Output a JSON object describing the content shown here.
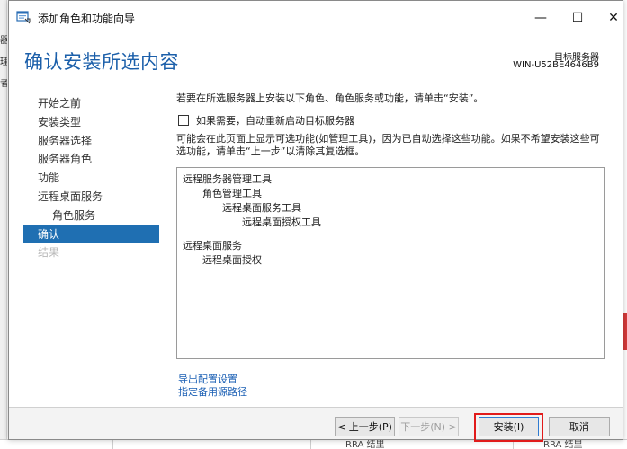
{
  "background": {
    "left_strip_chars": [
      "器",
      "理",
      "者"
    ],
    "bottom_cells": [
      "RRA 结里",
      "RRA 结里"
    ]
  },
  "window": {
    "title": "添加角色和功能向导",
    "minimize_glyph": "—",
    "maximize_glyph": "☐",
    "close_glyph": "✕"
  },
  "header": {
    "page_title": "确认安装所选内容",
    "target_server_label": "目标服务器",
    "target_server_name": "WIN-U52BE4646B9"
  },
  "nav": {
    "items": [
      {
        "label": "开始之前",
        "state": "normal"
      },
      {
        "label": "安装类型",
        "state": "normal"
      },
      {
        "label": "服务器选择",
        "state": "normal"
      },
      {
        "label": "服务器角色",
        "state": "normal"
      },
      {
        "label": "功能",
        "state": "normal"
      },
      {
        "label": "远程桌面服务",
        "state": "normal"
      },
      {
        "label": "角色服务",
        "state": "sub"
      },
      {
        "label": "确认",
        "state": "active"
      },
      {
        "label": "结果",
        "state": "disabled"
      }
    ]
  },
  "main": {
    "intro": "若要在所选服务器上安装以下角色、角色服务或功能，请单击“安装”。",
    "restart_checkbox_label": "如果需要，自动重新启动目标服务器",
    "restart_checked": false,
    "note": "可能会在此页面上显示可选功能(如管理工具)，因为已自动选择这些功能。如果不希望安装这些可选功能，请单击“上一步”以清除其复选框。",
    "items": [
      {
        "text": "远程服务器管理工具",
        "level": 0
      },
      {
        "text": "角色管理工具",
        "level": 1
      },
      {
        "text": "远程桌面服务工具",
        "level": 2
      },
      {
        "text": "远程桌面授权工具",
        "level": 3
      },
      {
        "text": "远程桌面服务",
        "level": 0
      },
      {
        "text": "远程桌面授权",
        "level": 1
      }
    ],
    "link_export": "导出配置设置",
    "link_alt_source": "指定备用源路径"
  },
  "footer": {
    "prev_label": "< 上一步(P)",
    "next_label": "下一步(N) >",
    "install_label": "安装(I)",
    "cancel_label": "取消"
  },
  "colors": {
    "accent": "#1f6fb2",
    "title_blue": "#1b5faa",
    "highlight_red": "#e11b1b"
  }
}
